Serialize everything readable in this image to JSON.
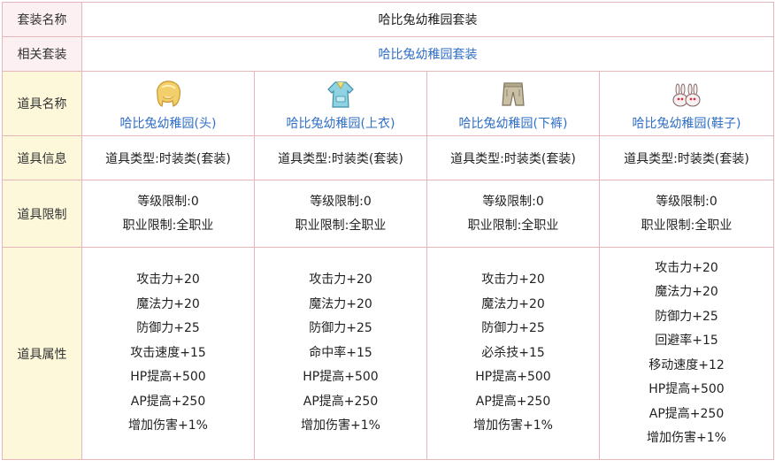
{
  "rows": {
    "set_name": {
      "label": "套装名称",
      "value": "哈比兔幼稚园套装"
    },
    "related": {
      "label": "相关套装",
      "value": "哈比兔幼稚园套装"
    },
    "item_name_label": "道具名称",
    "item_info_label": "道具信息",
    "item_limit_label": "道具限制",
    "item_props_label": "道具属性"
  },
  "items": [
    {
      "icon": "blonde-hair-icon",
      "name": "哈比兔幼稚园(头)",
      "info": "道具类型:时装类(套装)",
      "limits": [
        "等级限制:0",
        "职业限制:全职业"
      ],
      "props": [
        "攻击力+20",
        "魔法力+20",
        "防御力+25",
        "攻击速度+15",
        "HP提高+500",
        "AP提高+250",
        "增加伤害+1%"
      ]
    },
    {
      "icon": "smock-top-icon",
      "name": "哈比兔幼稚园(上衣)",
      "info": "道具类型:时装类(套装)",
      "limits": [
        "等级限制:0",
        "职业限制:全职业"
      ],
      "props": [
        "攻击力+20",
        "魔法力+20",
        "防御力+25",
        "命中率+15",
        "HP提高+500",
        "AP提高+250",
        "增加伤害+1%"
      ]
    },
    {
      "icon": "shorts-icon",
      "name": "哈比兔幼稚园(下裤)",
      "info": "道具类型:时装类(套装)",
      "limits": [
        "等级限制:0",
        "职业限制:全职业"
      ],
      "props": [
        "攻击力+20",
        "魔法力+20",
        "防御力+25",
        "必杀技+15",
        "HP提高+500",
        "AP提高+250",
        "增加伤害+1%"
      ]
    },
    {
      "icon": "bunny-shoes-icon",
      "name": "哈比兔幼稚园(鞋子)",
      "info": "道具类型:时装类(套装)",
      "limits": [
        "等级限制:0",
        "职业限制:全职业"
      ],
      "props": [
        "攻击力+20",
        "魔法力+20",
        "防御力+25",
        "回避率+15",
        "移动速度+12",
        "HP提高+500",
        "AP提高+250",
        "增加伤害+1%"
      ]
    }
  ]
}
